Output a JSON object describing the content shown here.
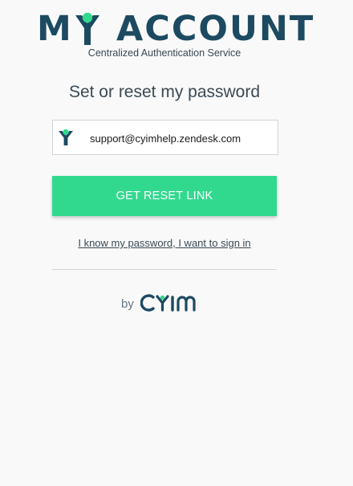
{
  "header": {
    "logo_text_m": "M",
    "logo_text_account": "ACCOUNT",
    "subtitle": "Centralized Authentication Service"
  },
  "form": {
    "heading": "Set or reset my password",
    "email_value": "support@cyimhelp.zendesk.com",
    "submit_label": "GET RESET LINK",
    "signin_link": "I know my password, I want to sign in"
  },
  "footer": {
    "by_label": "by",
    "brand_name": "CYIM"
  },
  "colors": {
    "brand_navy": "#1c4a61",
    "accent_green": "#31d98f",
    "background": "#f9f9f9"
  },
  "icons": {
    "logo_y": "user-y-logo-icon",
    "email_field": "user-y-icon"
  }
}
